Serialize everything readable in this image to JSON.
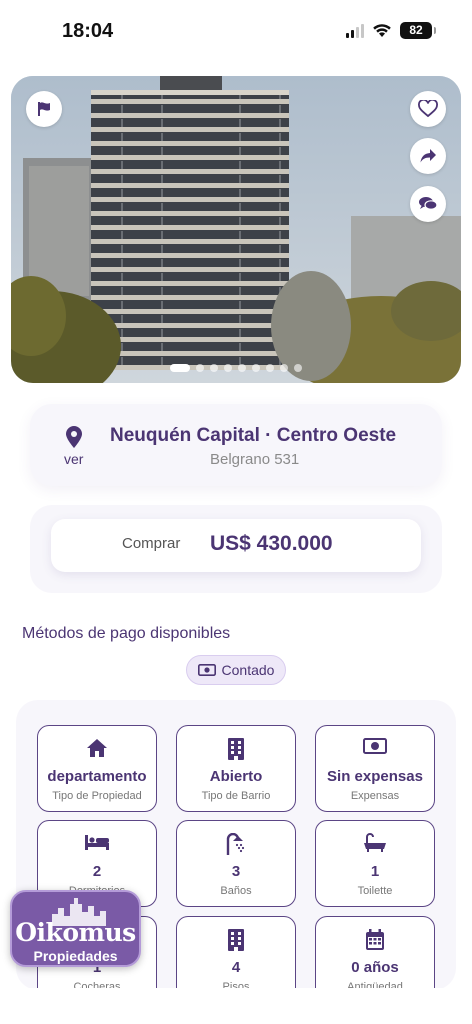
{
  "status_bar": {
    "time": "18:04",
    "battery": "82"
  },
  "hero": {
    "slide_count": 9,
    "active_slide": 1
  },
  "location": {
    "title": "Neuquén Capital · Centro Oeste",
    "address": "Belgrano  531",
    "map_link": "ver"
  },
  "price": {
    "operation": "Comprar",
    "value": "US$ 430.000"
  },
  "payment": {
    "title": "Métodos de pago disponibles",
    "methods": [
      "Contado"
    ]
  },
  "features": [
    {
      "value": "departamento",
      "label": "Tipo de Propiedad",
      "icon": "home-icon"
    },
    {
      "value": "Abierto",
      "label": "Tipo de Barrio",
      "icon": "building-icon"
    },
    {
      "value": "Sin expensas",
      "label": "Expensas",
      "icon": "money-icon"
    },
    {
      "value": "2",
      "label": "Dormitorios",
      "icon": "bed-icon"
    },
    {
      "value": "3",
      "label": "Baños",
      "icon": "shower-icon"
    },
    {
      "value": "1",
      "label": "Toilette",
      "icon": "bathtub-icon"
    },
    {
      "value": "1",
      "label": "Cocheras",
      "icon": "car-icon"
    },
    {
      "value": "4",
      "label": "Pisos",
      "icon": "building-icon"
    },
    {
      "value": "0 años",
      "label": "Antigüedad",
      "icon": "calendar-icon"
    }
  ],
  "logo": {
    "name": "Oikomus",
    "sub": "Propiedades"
  },
  "colors": {
    "primary": "#4b3573",
    "panel": "#f7f6fb",
    "chip": "#eee8f8"
  }
}
